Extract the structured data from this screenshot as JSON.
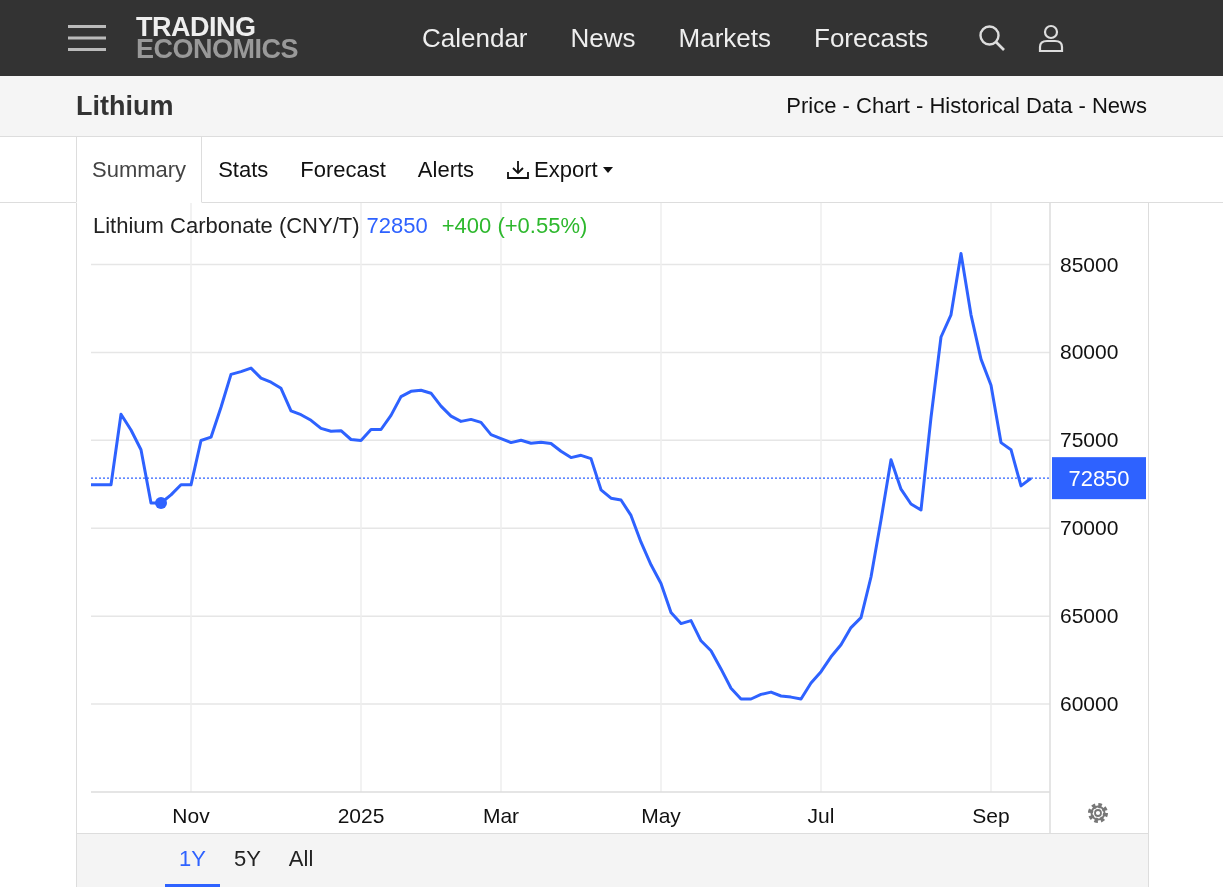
{
  "nav": {
    "logo_top": "TRADING",
    "logo_bottom": "ECONOMICS",
    "links": [
      "Calendar",
      "News",
      "Markets",
      "Forecasts"
    ]
  },
  "title_bar": {
    "title": "Lithium",
    "links": "Price - Chart - Historical Data - News"
  },
  "tabs": [
    {
      "label": "Summary",
      "selected": true,
      "kind": "tab"
    },
    {
      "label": "Stats",
      "selected": false,
      "kind": "tab"
    },
    {
      "label": "Forecast",
      "selected": false,
      "kind": "tab"
    },
    {
      "label": "Alerts",
      "selected": false,
      "kind": "tab"
    },
    {
      "label": "Export",
      "selected": false,
      "kind": "menu"
    }
  ],
  "chart_header": {
    "price": "72850",
    "change": "+400 (+0.55%)"
  },
  "chart_data": {
    "type": "line",
    "grid": true,
    "ylim": [
      55000,
      88500
    ],
    "yticks": [
      60000,
      65000,
      70000,
      75000,
      80000,
      85000
    ],
    "categories": [
      null,
      null,
      null,
      null,
      null,
      null,
      null,
      null,
      null,
      null,
      "Nov",
      null,
      null,
      null,
      null,
      null,
      null,
      null,
      null,
      null,
      null,
      null,
      null,
      null,
      null,
      null,
      null,
      "2025",
      null,
      null,
      null,
      null,
      null,
      null,
      null,
      null,
      null,
      null,
      null,
      null,
      null,
      "Mar",
      null,
      null,
      null,
      null,
      null,
      null,
      null,
      null,
      null,
      null,
      null,
      null,
      null,
      null,
      null,
      "May",
      null,
      null,
      null,
      null,
      null,
      null,
      null,
      null,
      null,
      null,
      null,
      null,
      null,
      null,
      null,
      "Jul",
      null,
      null,
      null,
      null,
      null,
      null,
      null,
      null,
      null,
      null,
      null,
      null,
      null,
      null,
      null,
      null,
      "Sep",
      null,
      null,
      null,
      null
    ],
    "series": [
      {
        "name": "Lithium Carbonate (CNY/T)",
        "color": "#2e62ff",
        "values": [
          72470,
          72470,
          72470,
          76480,
          75590,
          74470,
          71440,
          71440,
          71900,
          72470,
          72470,
          74990,
          75180,
          76880,
          78750,
          78910,
          79110,
          78540,
          78310,
          77960,
          76680,
          76460,
          76140,
          75680,
          75520,
          75550,
          75050,
          74990,
          75620,
          75620,
          76420,
          77490,
          77790,
          77850,
          77680,
          76950,
          76380,
          76080,
          76190,
          76020,
          75330,
          75100,
          74870,
          75010,
          74840,
          74890,
          74820,
          74380,
          74020,
          74150,
          73960,
          72190,
          71710,
          71610,
          70730,
          69210,
          67920,
          66860,
          65210,
          64580,
          64750,
          63600,
          63030,
          62000,
          60900,
          60290,
          60290,
          60550,
          60680,
          60460,
          60400,
          60290,
          61200,
          61840,
          62690,
          63380,
          64350,
          64920,
          67230,
          70470,
          73900,
          72220,
          71380,
          71040,
          76300,
          80880,
          82140,
          85630,
          82140,
          79620,
          78130,
          74870,
          74470,
          72410,
          72850
        ]
      }
    ],
    "ref_lines": [
      {
        "axis": "y",
        "value": 72850,
        "label": "72850"
      }
    ]
  },
  "ranges": [
    {
      "label": "1Y",
      "selected": true
    },
    {
      "label": "5Y",
      "selected": false
    },
    {
      "label": "All",
      "selected": false
    }
  ]
}
